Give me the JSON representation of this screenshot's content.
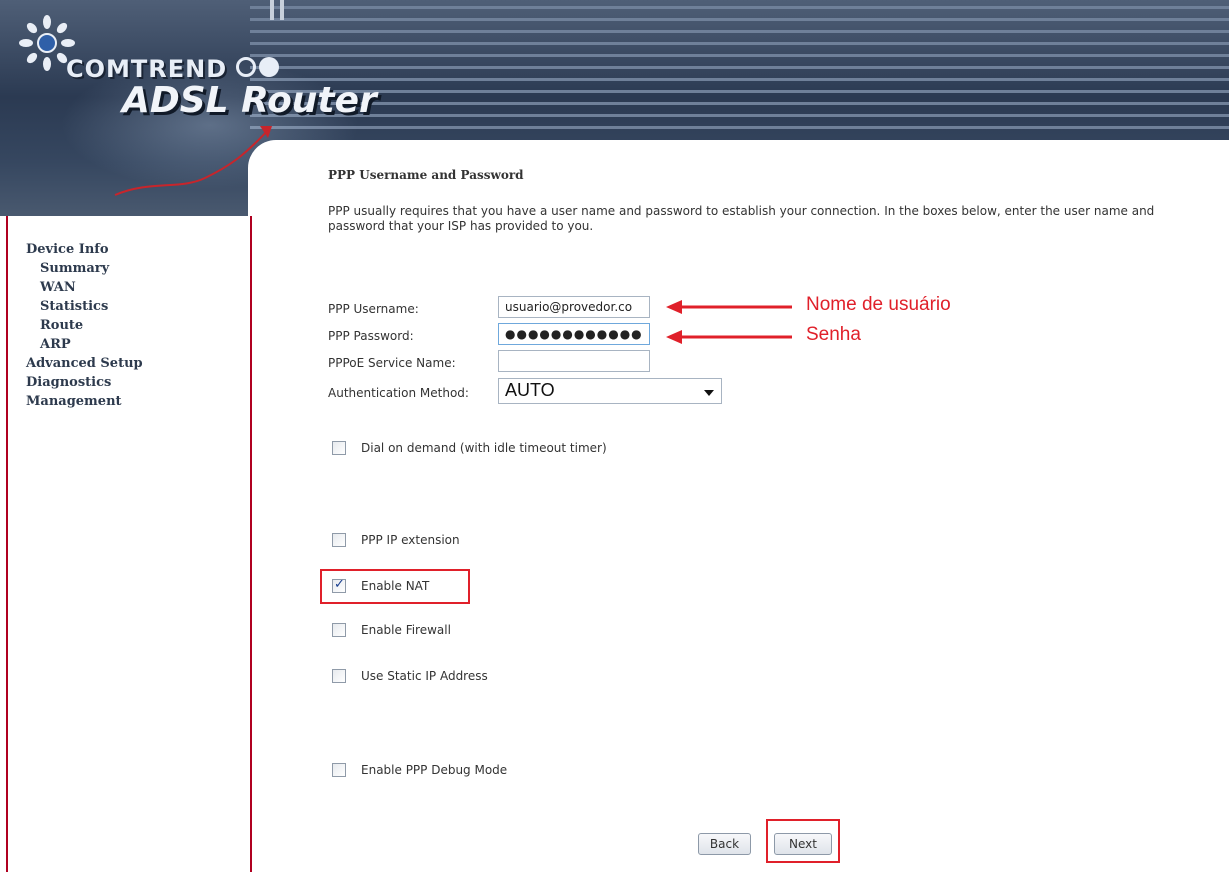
{
  "header": {
    "brand": "COMTREND",
    "product": "ADSL Router"
  },
  "sidebar": {
    "items": [
      {
        "label": "Device Info",
        "level": 0
      },
      {
        "label": "Summary",
        "level": 1
      },
      {
        "label": "WAN",
        "level": 1
      },
      {
        "label": "Statistics",
        "level": 1
      },
      {
        "label": "Route",
        "level": 1
      },
      {
        "label": "ARP",
        "level": 1
      },
      {
        "label": "Advanced Setup",
        "level": 0
      },
      {
        "label": "Diagnostics",
        "level": 0
      },
      {
        "label": "Management",
        "level": 0
      }
    ]
  },
  "main": {
    "title": "PPP Username and Password",
    "description": "PPP usually requires that you have a user name and password to establish your connection. In the boxes below, enter the user name and password that your ISP has provided to you.",
    "form": {
      "username_label": "PPP Username:",
      "username_value": "usuario@provedor.co",
      "password_label": "PPP Password:",
      "password_value": "●●●●●●●●●●●●",
      "service_label": "PPPoE Service Name:",
      "service_value": "",
      "auth_label": "Authentication Method:",
      "auth_value": "AUTO"
    },
    "checkboxes": [
      {
        "label": "Dial on demand (with idle timeout timer)",
        "checked": false
      },
      {
        "label": "PPP IP extension",
        "checked": false
      },
      {
        "label": "Enable NAT",
        "checked": true
      },
      {
        "label": "Enable Firewall",
        "checked": false
      },
      {
        "label": "Use Static IP Address",
        "checked": false
      },
      {
        "label": "Enable PPP Debug Mode",
        "checked": false
      }
    ],
    "buttons": {
      "back": "Back",
      "next": "Next"
    }
  },
  "annotations": {
    "username_note": "Nome de usuário",
    "password_note": "Senha"
  },
  "colors": {
    "highlight": "#e0202a",
    "sidebar_border": "#b00020",
    "banner": "#2b3a52"
  },
  "icons": {
    "logo": "comtrend-globe-icon",
    "dropdown": "chevron-down-icon",
    "arrow": "arrow-left-icon"
  }
}
